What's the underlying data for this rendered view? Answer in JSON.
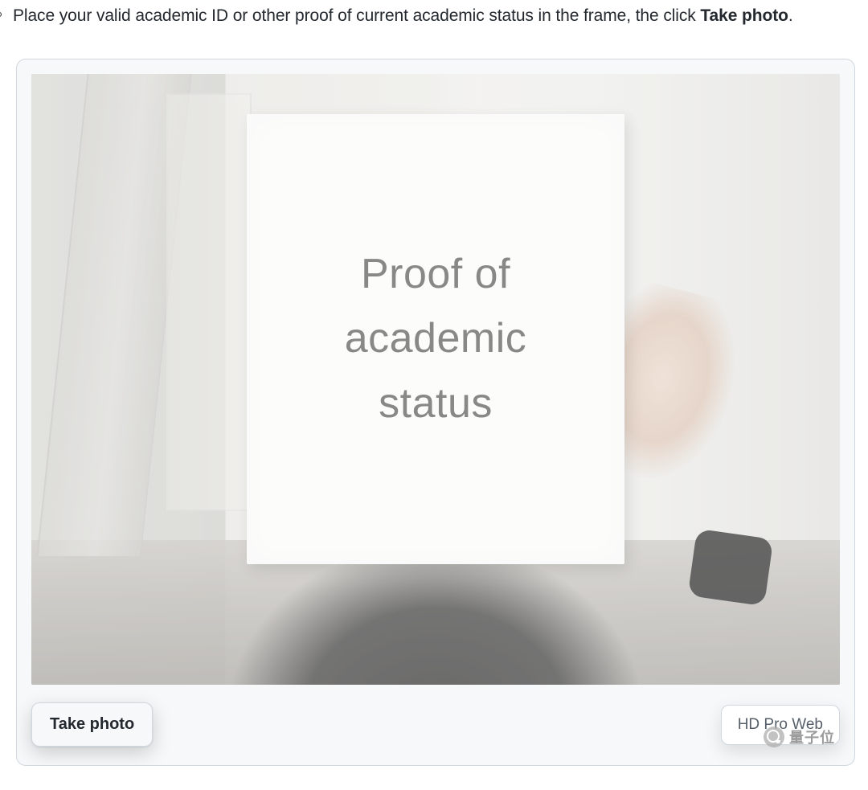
{
  "instruction": {
    "text_prefix": "Place your valid academic ID or other proof of current academic status in the frame, the click ",
    "bold_part": "Take photo",
    "text_suffix": "."
  },
  "paper_sign": {
    "line1": "Proof of",
    "line2": "academic",
    "line3": "status"
  },
  "controls": {
    "take_photo_label": "Take photo",
    "camera_device_label": "HD Pro Web"
  },
  "watermark": {
    "text": "量子位"
  }
}
